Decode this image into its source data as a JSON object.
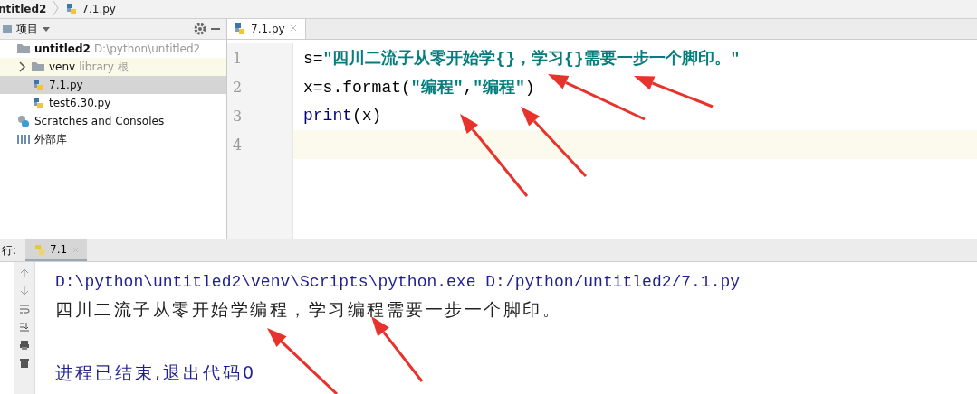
{
  "breadcrumb": [
    {
      "label": "ntitled2",
      "kind": "project"
    },
    {
      "label": "7.1.py",
      "kind": "file"
    }
  ],
  "project_panel": {
    "title": "项目",
    "tree": [
      {
        "label": "untitled2",
        "hint": "D:\\python\\untitled2",
        "kind": "folder",
        "expanded": true,
        "selected": false,
        "children": [
          {
            "label": "venv",
            "hint": "library 根",
            "kind": "folder",
            "expanded": false,
            "selected": false,
            "excluded": true
          },
          {
            "label": "7.1.py",
            "kind": "python",
            "selected": true
          },
          {
            "label": "test6.30.py",
            "kind": "python",
            "selected": false
          }
        ]
      },
      {
        "label": "Scratches and Consoles",
        "kind": "scratches",
        "selected": false
      },
      {
        "label": "外部库",
        "kind": "library",
        "selected": false
      }
    ]
  },
  "editor": {
    "tabs": [
      {
        "label": "7.1.py",
        "selected": true
      }
    ],
    "lines": [
      {
        "number": "1",
        "current": false,
        "segments": [
          {
            "text": "s=",
            "kind": "plain"
          },
          {
            "text": "\"四川二流子从零开始学{}，学习{}需要一步一个脚印。\"",
            "kind": "string"
          }
        ]
      },
      {
        "number": "2",
        "current": false,
        "segments": [
          {
            "text": "x=s.format(",
            "kind": "plain"
          },
          {
            "text": "\"编程\"",
            "kind": "string"
          },
          {
            "text": ",",
            "kind": "plain"
          },
          {
            "text": "\"编程\"",
            "kind": "string"
          },
          {
            "text": ")",
            "kind": "plain"
          }
        ]
      },
      {
        "number": "3",
        "current": false,
        "segments": [
          {
            "text": "print",
            "kind": "builtin"
          },
          {
            "text": "(x)",
            "kind": "plain"
          }
        ]
      },
      {
        "number": "4",
        "current": true
      }
    ]
  },
  "run_panel": {
    "label": "行:",
    "tabs": [
      {
        "label": "7.1",
        "selected": true
      }
    ],
    "output": [
      {
        "text": "D:\\python\\untitled2\\venv\\Scripts\\python.exe D:/python/untitled2/7.1.py",
        "kind": "command"
      },
      {
        "text": "四川二流子从零开始学编程，学习编程需要一步一个脚印。",
        "kind": "stdout"
      },
      {
        "text": "进程已结束,退出代码0",
        "kind": "exit"
      }
    ]
  }
}
